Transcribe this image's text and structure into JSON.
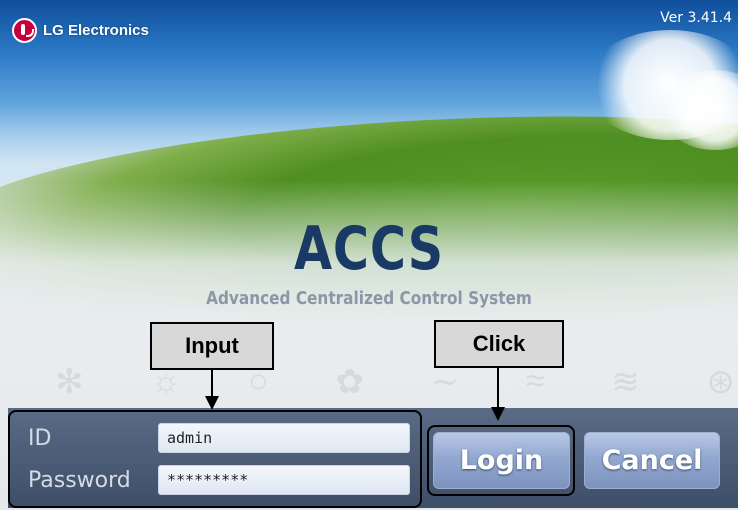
{
  "header": {
    "brand": "LG Electronics",
    "version": "Ver 3.41.4"
  },
  "hero": {
    "title": "ACCS",
    "subtitle": "Advanced Centralized Control System"
  },
  "mode_icons": [
    "snowflake-icon",
    "sun-icon",
    "drop-icon",
    "fan-icon",
    "wave-icon",
    "wind-icon",
    "steam-icon",
    "turbo-fan-icon"
  ],
  "login": {
    "id_label": "ID",
    "id_value": "admin",
    "password_label": "Password",
    "password_value": "*********",
    "login_button": "Login",
    "cancel_button": "Cancel"
  },
  "annotations": {
    "input_label": "Input",
    "click_label": "Click"
  },
  "colors": {
    "panel": "#4a5a76",
    "button": "#93a8d0",
    "title": "#1a3a66",
    "logo": "#c6003f"
  }
}
